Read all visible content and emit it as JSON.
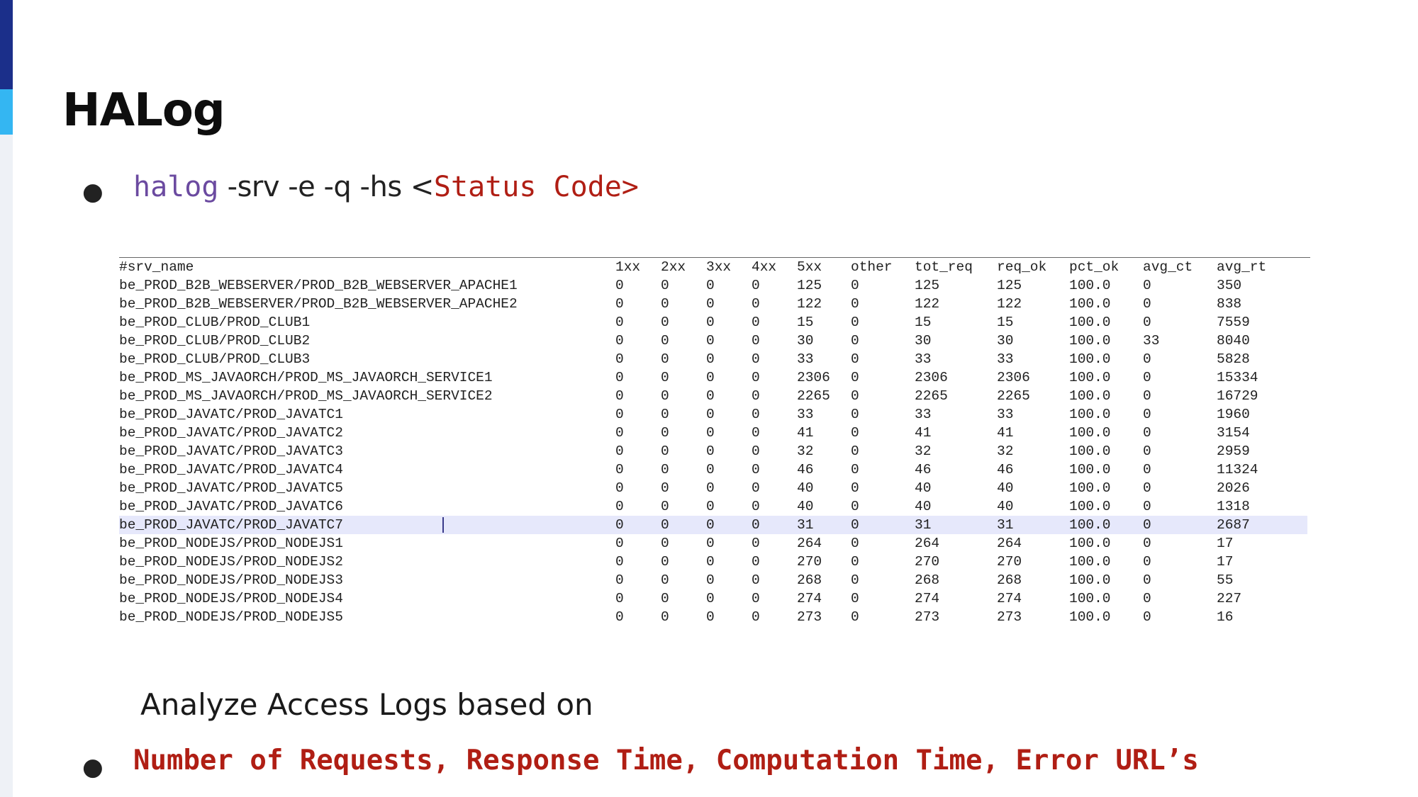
{
  "slide": {
    "title": "HALog",
    "command": {
      "keyword": "halog",
      "args": " -srv -e -q -hs <",
      "placeholder": "Status Code>"
    },
    "subtitle": "Analyze Access Logs based on",
    "metrics": "Number of Requests, Response Time, Computation Time, Error URL’s"
  },
  "colors": {
    "accent_dark": "#1b2f8a",
    "accent_light": "#34b6f2",
    "keyword": "#6b4aa0",
    "highlight": "#b01e14",
    "selected_row": "#e6e8fb"
  },
  "table": {
    "columns": [
      "#srv_name",
      "1xx",
      "2xx",
      "3xx",
      "4xx",
      "5xx",
      "other",
      "tot_req",
      "req_ok",
      "pct_ok",
      "avg_ct",
      "avg_rt"
    ],
    "selected_index": 13,
    "rows": [
      [
        "be_PROD_B2B_WEBSERVER/PROD_B2B_WEBSERVER_APACHE1",
        "0",
        "0",
        "0",
        "0",
        "125",
        "0",
        "125",
        "125",
        "100.0",
        "0",
        "350"
      ],
      [
        "be_PROD_B2B_WEBSERVER/PROD_B2B_WEBSERVER_APACHE2",
        "0",
        "0",
        "0",
        "0",
        "122",
        "0",
        "122",
        "122",
        "100.0",
        "0",
        "838"
      ],
      [
        "be_PROD_CLUB/PROD_CLUB1",
        "0",
        "0",
        "0",
        "0",
        "15",
        "0",
        "15",
        "15",
        "100.0",
        "0",
        "7559"
      ],
      [
        "be_PROD_CLUB/PROD_CLUB2",
        "0",
        "0",
        "0",
        "0",
        "30",
        "0",
        "30",
        "30",
        "100.0",
        "33",
        "8040"
      ],
      [
        "be_PROD_CLUB/PROD_CLUB3",
        "0",
        "0",
        "0",
        "0",
        "33",
        "0",
        "33",
        "33",
        "100.0",
        "0",
        "5828"
      ],
      [
        "be_PROD_MS_JAVAORCH/PROD_MS_JAVAORCH_SERVICE1",
        "0",
        "0",
        "0",
        "0",
        "2306",
        "0",
        "2306",
        "2306",
        "100.0",
        "0",
        "15334"
      ],
      [
        "be_PROD_MS_JAVAORCH/PROD_MS_JAVAORCH_SERVICE2",
        "0",
        "0",
        "0",
        "0",
        "2265",
        "0",
        "2265",
        "2265",
        "100.0",
        "0",
        "16729"
      ],
      [
        "be_PROD_JAVATC/PROD_JAVATC1",
        "0",
        "0",
        "0",
        "0",
        "33",
        "0",
        "33",
        "33",
        "100.0",
        "0",
        "1960"
      ],
      [
        "be_PROD_JAVATC/PROD_JAVATC2",
        "0",
        "0",
        "0",
        "0",
        "41",
        "0",
        "41",
        "41",
        "100.0",
        "0",
        "3154"
      ],
      [
        "be_PROD_JAVATC/PROD_JAVATC3",
        "0",
        "0",
        "0",
        "0",
        "32",
        "0",
        "32",
        "32",
        "100.0",
        "0",
        "2959"
      ],
      [
        "be_PROD_JAVATC/PROD_JAVATC4",
        "0",
        "0",
        "0",
        "0",
        "46",
        "0",
        "46",
        "46",
        "100.0",
        "0",
        "11324"
      ],
      [
        "be_PROD_JAVATC/PROD_JAVATC5",
        "0",
        "0",
        "0",
        "0",
        "40",
        "0",
        "40",
        "40",
        "100.0",
        "0",
        "2026"
      ],
      [
        "be_PROD_JAVATC/PROD_JAVATC6",
        "0",
        "0",
        "0",
        "0",
        "40",
        "0",
        "40",
        "40",
        "100.0",
        "0",
        "1318"
      ],
      [
        "be_PROD_JAVATC/PROD_JAVATC7",
        "0",
        "0",
        "0",
        "0",
        "31",
        "0",
        "31",
        "31",
        "100.0",
        "0",
        "2687"
      ],
      [
        "be_PROD_NODEJS/PROD_NODEJS1",
        "0",
        "0",
        "0",
        "0",
        "264",
        "0",
        "264",
        "264",
        "100.0",
        "0",
        "17"
      ],
      [
        "be_PROD_NODEJS/PROD_NODEJS2",
        "0",
        "0",
        "0",
        "0",
        "270",
        "0",
        "270",
        "270",
        "100.0",
        "0",
        "17"
      ],
      [
        "be_PROD_NODEJS/PROD_NODEJS3",
        "0",
        "0",
        "0",
        "0",
        "268",
        "0",
        "268",
        "268",
        "100.0",
        "0",
        "55"
      ],
      [
        "be_PROD_NODEJS/PROD_NODEJS4",
        "0",
        "0",
        "0",
        "0",
        "274",
        "0",
        "274",
        "274",
        "100.0",
        "0",
        "227"
      ],
      [
        "be_PROD_NODEJS/PROD_NODEJS5",
        "0",
        "0",
        "0",
        "0",
        "273",
        "0",
        "273",
        "273",
        "100.0",
        "0",
        "16"
      ]
    ]
  }
}
